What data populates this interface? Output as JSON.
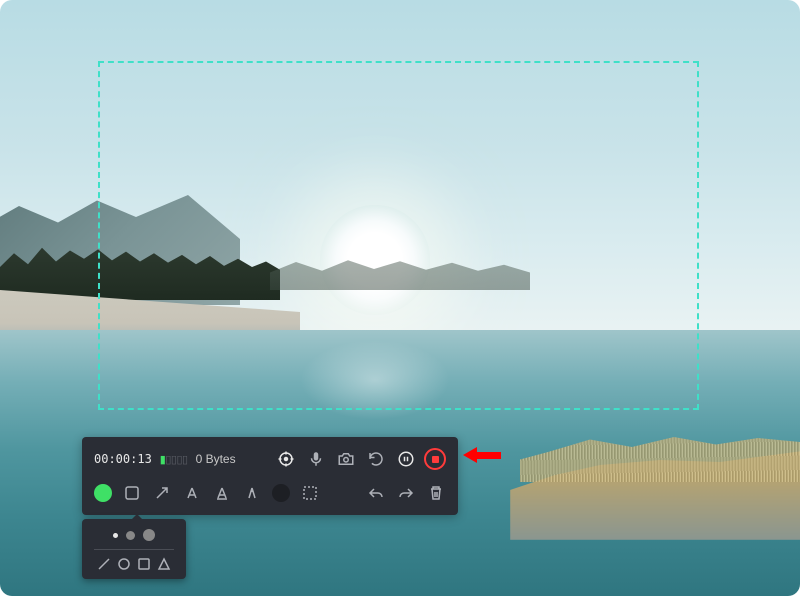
{
  "recording": {
    "timer": "00:00:13",
    "size": "0 Bytes",
    "audio_level": {
      "active_bars": 1,
      "total_bars": 5
    }
  },
  "toolbar": {
    "color": "#3fe066",
    "eraser_color": "#1d1f24"
  },
  "icons": {
    "cursor": "cursor-icon",
    "mic": "microphone-icon",
    "camera": "camera-icon",
    "restart": "restart-icon",
    "pause": "pause-icon",
    "stop": "stop-icon",
    "rect": "rectangle-tool",
    "arrow": "arrow-tool",
    "text": "text-tool",
    "highlight": "highlight-tool",
    "draw": "draw-tool",
    "eraser": "eraser-tool",
    "select": "select-tool",
    "undo": "undo-icon",
    "redo": "redo-icon",
    "trash": "trash-icon"
  },
  "popup": {
    "sizes": [
      "small",
      "medium",
      "large"
    ],
    "shapes": [
      "line",
      "circle",
      "square",
      "triangle"
    ]
  }
}
